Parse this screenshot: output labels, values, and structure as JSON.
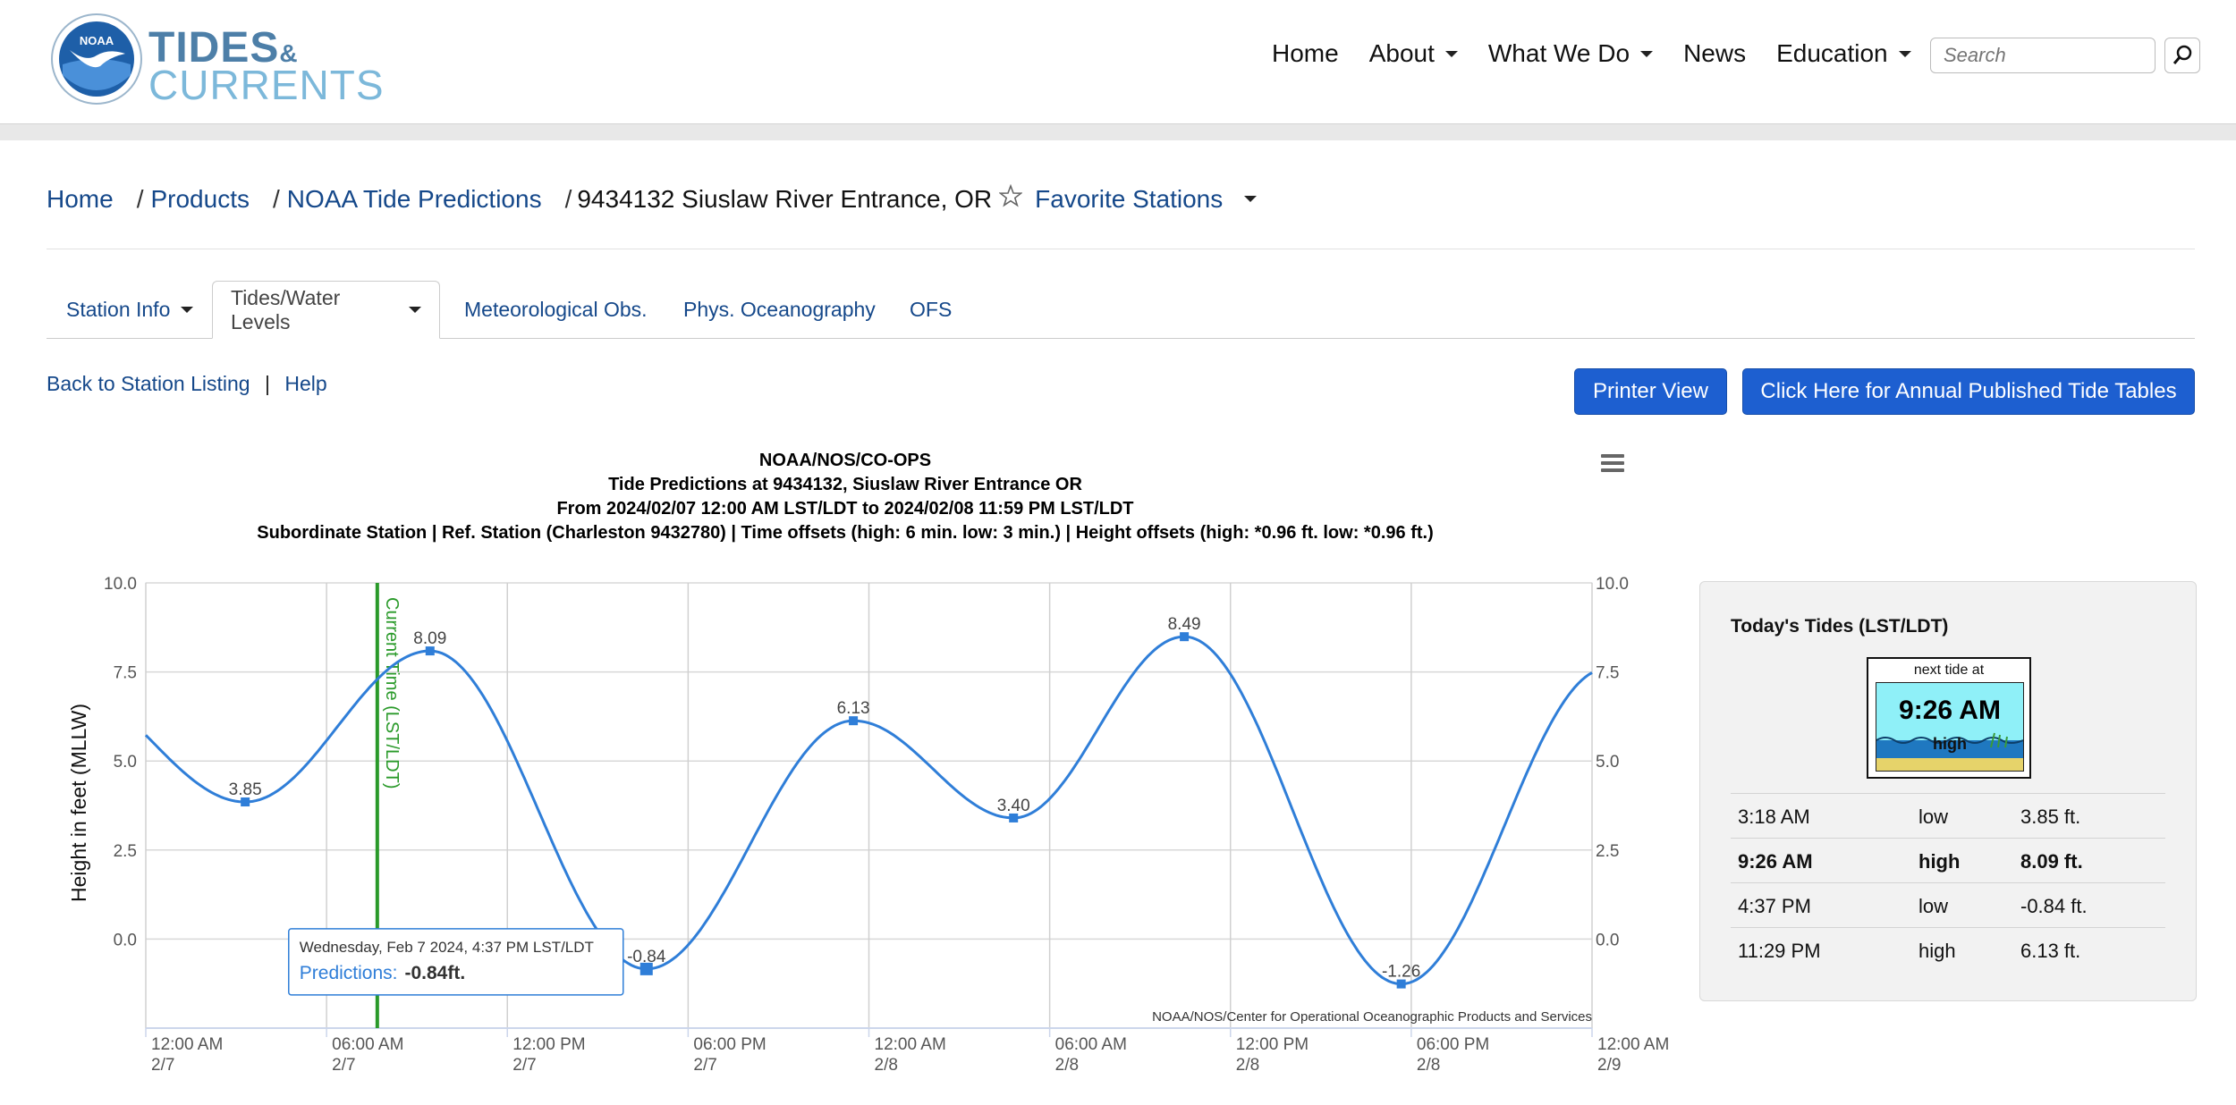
{
  "header": {
    "logo_badge": "NOAA",
    "logo_line1": "TIDES",
    "logo_amp": "&",
    "logo_line2": "CURRENTS",
    "nav": [
      "Home",
      "About",
      "What We Do",
      "News",
      "Education"
    ],
    "search_placeholder": "Search"
  },
  "breadcrumb": {
    "items": [
      "Home",
      "Products",
      "NOAA Tide Predictions"
    ],
    "current": "9434132 Siuslaw River Entrance, OR",
    "favorite": "Favorite Stations"
  },
  "tabs": [
    "Station Info",
    "Tides/Water Levels",
    "Meteorological Obs.",
    "Phys. Oceanography",
    "OFS"
  ],
  "links": {
    "back": "Back to Station Listing",
    "sep": "|",
    "help": "Help"
  },
  "buttons": {
    "printer": "Printer View",
    "annual": "Click Here for Annual Published Tide Tables"
  },
  "chart_data": {
    "type": "line",
    "title_lines": [
      "NOAA/NOS/CO-OPS",
      "Tide Predictions at 9434132, Siuslaw River Entrance OR",
      "From 2024/02/07 12:00 AM LST/LDT to 2024/02/08 11:59 PM LST/LDT",
      "Subordinate Station | Ref. Station (Charleston 9432780) | Time offsets (high: 6 min. low: 3 min.) | Height offsets (high: *0.96 ft. low: *0.96 ft.)"
    ],
    "ylabel": "Height in feet (MLLW)",
    "ylim": [
      -2.5,
      10
    ],
    "yticks": [
      "10.0",
      "7.5",
      "5.0",
      "2.5",
      "0.0"
    ],
    "xlim": [
      "2024-02-07 00:00",
      "2024-02-09 00:00"
    ],
    "xticks": [
      {
        "time": "12:00 AM",
        "date": "2/7"
      },
      {
        "time": "06:00 AM",
        "date": "2/7"
      },
      {
        "time": "12:00 PM",
        "date": "2/7"
      },
      {
        "time": "06:00 PM",
        "date": "2/7"
      },
      {
        "time": "12:00 AM",
        "date": "2/8"
      },
      {
        "time": "06:00 AM",
        "date": "2/8"
      },
      {
        "time": "12:00 PM",
        "date": "2/8"
      },
      {
        "time": "06:00 PM",
        "date": "2/8"
      },
      {
        "time": "12:00 AM",
        "date": "2/9"
      }
    ],
    "series": [
      {
        "name": "Predictions",
        "color": "#2f7ed8",
        "extremes": [
          {
            "x": "2024-02-07 03:18",
            "y": 3.85,
            "label": "3.85"
          },
          {
            "x": "2024-02-07 09:26",
            "y": 8.09,
            "label": "8.09"
          },
          {
            "x": "2024-02-07 16:37",
            "y": -0.84,
            "label": "-0.84"
          },
          {
            "x": "2024-02-07 23:29",
            "y": 6.13,
            "label": "6.13"
          },
          {
            "x": "2024-02-08 04:48",
            "y": 3.4,
            "label": "3.40"
          },
          {
            "x": "2024-02-08 10:28",
            "y": 8.49,
            "label": "8.49"
          },
          {
            "x": "2024-02-08 17:40",
            "y": -1.26,
            "label": "-1.26"
          }
        ],
        "start": {
          "x": "2024-02-07 00:00",
          "y": 5.4
        },
        "end": {
          "x": "2024-02-09 00:00",
          "y": 6.6
        }
      }
    ],
    "current_time": {
      "x": "2024-02-07 07:41",
      "label": "Current Time (LST/LDT)",
      "color": "#2a9a2a"
    },
    "tooltip": {
      "header": "Wednesday, Feb 7 2024, 4:37 PM LST/LDT",
      "series": "Predictions:",
      "value": "-0.84ft."
    },
    "credit": "NOAA/NOS/Center for Operational Oceanographic Products and Services",
    "grid": true,
    "legend": "none"
  },
  "tides_panel": {
    "title": "Today's Tides (LST/LDT)",
    "next_label": "next tide at",
    "next_time": "9:26 AM",
    "next_type": "high",
    "rows": [
      {
        "time": "3:18 AM",
        "type": "low",
        "height": "3.85 ft.",
        "bold": false
      },
      {
        "time": "9:26 AM",
        "type": "high",
        "height": "8.09 ft.",
        "bold": true
      },
      {
        "time": "4:37 PM",
        "type": "low",
        "height": "-0.84 ft.",
        "bold": false
      },
      {
        "time": "11:29 PM",
        "type": "high",
        "height": "6.13 ft.",
        "bold": false
      }
    ]
  }
}
